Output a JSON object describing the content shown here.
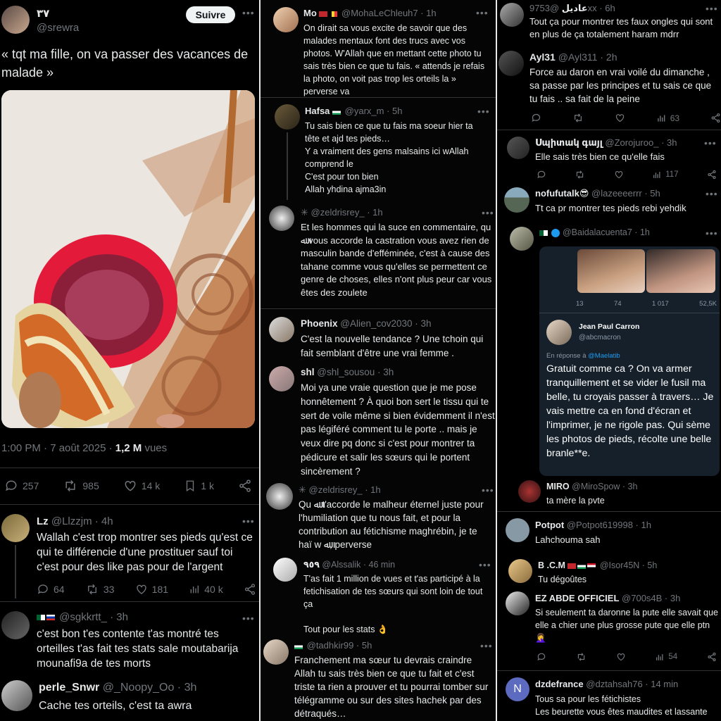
{
  "col1": {
    "main": {
      "name": "٣٧",
      "handle": "@srewra",
      "follow_label": "Suivre",
      "text": "« tqt ma fille, on va passer des vacances de malade »",
      "time": "1:00 PM · 7 août 2025 · ",
      "views_count": "1,2 M",
      "views_label": " vues",
      "replies": "257",
      "retweets": "985",
      "likes": "14 k",
      "bookmarks": "1 k"
    },
    "replies": [
      {
        "name": "Lz",
        "handle": "@Llzzjm · 4h",
        "text": "Wallah c'est trop montrer ses pieds qu'est ce qui te différencie d'une prostituer sauf toi c'est pour des like pas pour de l'argent",
        "replies": "64",
        "retweets": "33",
        "likes": "181",
        "views": "40 k"
      },
      {
        "name": "",
        "handle": "@sgkkrtt_ · 3h",
        "text": "c'est bon t'es contente t'as montré tes orteilles t'as fait tes stats sale moutabarija mounafi9a de tes morts"
      },
      {
        "name": "perle_Snwr",
        "handle": "@_Noopy_Oo · 3h",
        "text": "Cache tes orteils, c'est ta awra"
      }
    ]
  },
  "col2": {
    "replies": [
      {
        "name": "Mo",
        "handle": "@MohaLeChleuh7 · 1h",
        "text": "On dirait sa vous excite de savoir que des malades mentaux font des trucs avec vos photos. W'Allah  que en mettant cette photo tu sais très bien ce que tu fais. « attends je refais la photo, on voit pas trop les orteils la » perverse va"
      },
      {
        "name": "Hafsa",
        "handle": "@yarx_m · 5h",
        "text": "Tu sais bien ce que tu fais ma soeur hier ta tête et ajd tes pieds…\nY a vraiment des gens malsains ici wAllah comprend le\nC'est pour ton bien\nAllah yhdina ajma3in"
      },
      {
        "name": "",
        "handle": "@zeldrisrey_ · 1h",
        "text": "Et les hommes qui la suce en commentaire, qu ﷲ vous accorde la castration vous avez rien de masculin bande d'efféminée, c'est à cause des tahane comme vous qu'elles se permettent ce genre de choses, elles n'ont plus peur car vous êtes des zoulete"
      },
      {
        "name": "Phoenix",
        "handle": "@Alien_cov2030 · 3h",
        "text": "C'est la nouvelle tendance ? Une tchoin qui fait semblant d'être une vrai femme ."
      },
      {
        "name": "shl",
        "handle": "@shl_sousou · 3h",
        "text": "Moi ya une vraie question que je me pose honnêtement ? À quoi bon sert le tissu qui te sert de voile même si bien évidemment il n'est pas légiféré comment tu le porte .. mais je veux dire pq donc si c'est pour montrer ta pédicure et salir les sœurs qui le portent sincèrement ?"
      },
      {
        "name": "",
        "handle": "@zeldrisrey_ · 1h",
        "text": "Qu ﷲ t'accorde le malheur éternel juste pour l'humiliation que tu nous fait, et pour la contribution au fétichisme maghrébin, je te haï w ﷲ, perverse"
      },
      {
        "name": "٩٥٩",
        "handle": "@Alssalik · 46 min",
        "text": "T'as fait 1 million de vues et t'as participé à la fetichisation de tes sœurs qui sont loin de tout ça\n\nTout pour les stats 👌"
      },
      {
        "name": "",
        "handle": "@tadhkir99 · 5h",
        "text": "Franchement ma sœur tu devrais craindre Allah tu sais très bien ce que tu fait et c'est triste ta rien a prouver et tu pourrai tomber sur télégramme ou sur des sites hachek par des détraqués…"
      }
    ]
  },
  "col3": {
    "replies": [
      {
        "name": "عاديل",
        "handle": "@9753xx · 6h",
        "text": "Tout ça pour montrer tes faux ongles qui sont en plus de ça totalement haram mdrr"
      },
      {
        "name": "Ayl31",
        "handle": "@Ayl311 · 2h",
        "text": "Force au daron en vrai voilé du dimanche , sa passe par les principes et tu sais ce que tu fais .. sa fait de la peine",
        "views": "63"
      },
      {
        "name": "Սպիտակ գայլ",
        "handle": "@Zorojuroo_ · 3h",
        "text": "Elle sais très bien ce qu'elle fais",
        "views": "117"
      },
      {
        "name": "nofufutalk😎",
        "handle": "@lazeeeerrr · 5h",
        "text": "Tt ca pr montrer tes pieds rebi yehdik"
      },
      {
        "name": "",
        "handle": "@Baidalacuenta7 · 1h",
        "text": ""
      },
      {
        "name": "MIRO",
        "handle": "@MiroSpow · 3h",
        "text": "ta mère la pvte"
      },
      {
        "name": "Potpot",
        "handle": "@Potpot619998 · 1h",
        "text": "Lahchouma sah"
      },
      {
        "name": "B .C.M",
        "handle": "@Isor45N · 5h",
        "text": "Tu dégoûtes"
      },
      {
        "name": "EZ ABDE OFFICIEL",
        "handle": "@700s4B · 3h",
        "text": "Si seulement ta daronne la pute elle savait que elle a chier une plus grosse pute que elle ptn 🤦‍♀️",
        "views": "54"
      },
      {
        "name": "dzdefrance",
        "handle": "@dztahsah76 · 14 min",
        "text": "Tous sa pour les fétichistes\nLes beurette vous êtes maudites et lassante"
      }
    ],
    "quote": {
      "stats": [
        "13",
        "74",
        "1 017",
        "52,5K"
      ],
      "name": "Jean Paul Carron",
      "handle": "@abcmacron",
      "reply_to_label": "En réponse à ",
      "reply_to_handle": "@Maelatib",
      "text": "Gratuit comme ca ? On va armer tranquillement et se vider le fusil ma belle, tu croyais passer à travers… Je vais mettre ca en fond d'écran et l'imprimer, je ne rigole pas. Qui sème les photos de pieds, récolte une belle branle**e."
    },
    "avatar_letter": "N"
  },
  "colors": {
    "bg": "#000000",
    "text": "#e7e9ea",
    "muted": "#71767b",
    "divider": "#2f3336",
    "link": "#1d9bf0",
    "follow_bg": "#eff3f4"
  }
}
